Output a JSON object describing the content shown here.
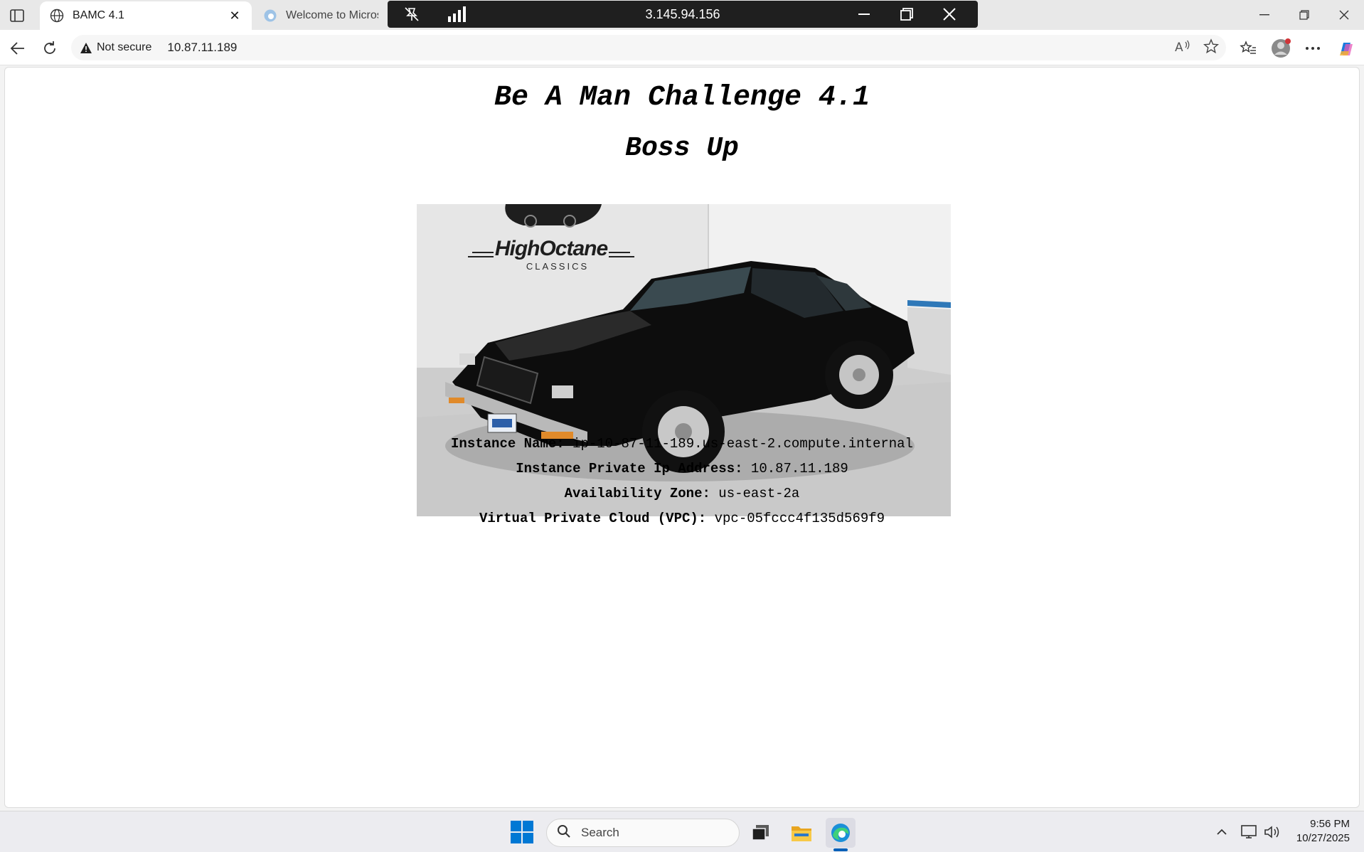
{
  "browser": {
    "tabs": [
      {
        "title": "BAMC 4.1",
        "active": true
      },
      {
        "title": "Welcome to Microsoft",
        "active": false
      }
    ],
    "address": {
      "security_label": "Not secure",
      "url": "10.87.11.189"
    }
  },
  "rdp": {
    "host": "3.145.94.156"
  },
  "page": {
    "title": "Be A Man Challenge 4.1",
    "subtitle": "Boss Up",
    "image_brand_text": "HIGHOCTANE CLASSICS",
    "info": [
      {
        "label": "Instance Name:",
        "value": "ip-10-87-11-189.us-east-2.compute.internal"
      },
      {
        "label": "Instance Private Ip Address:",
        "value": "10.87.11.189"
      },
      {
        "label": "Availability Zone:",
        "value": "us-east-2a"
      },
      {
        "label": "Virtual Private Cloud (VPC):",
        "value": "vpc-05fccc4f135d569f9"
      }
    ]
  },
  "taskbar": {
    "search_label": "Search",
    "time": "9:56 PM",
    "date": "10/27/2025"
  },
  "colors": {
    "edge_blue": "#005fb8",
    "warning": "#202020",
    "profile_dot": "#d13438"
  }
}
